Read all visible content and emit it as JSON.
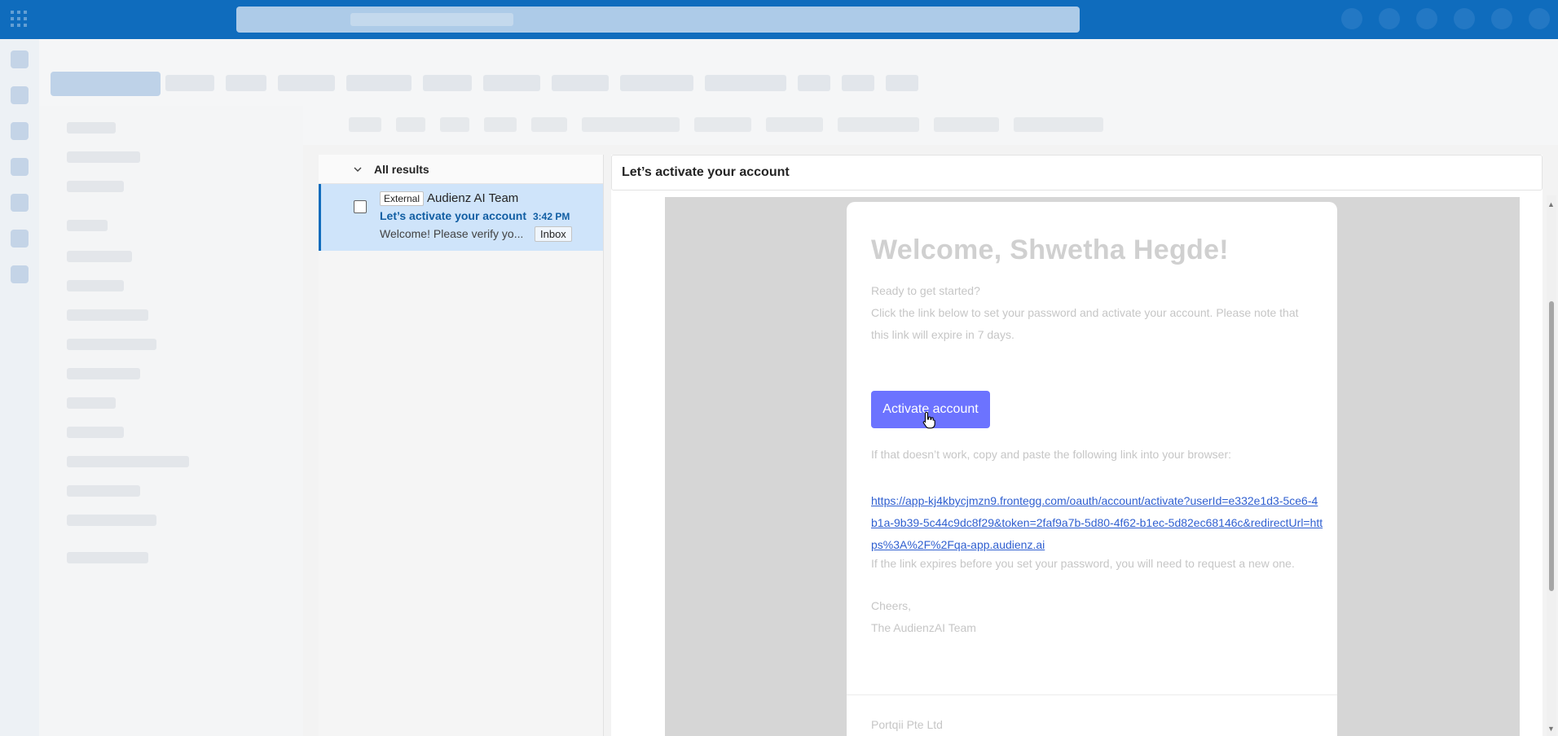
{
  "message_list": {
    "header": "All results",
    "items": [
      {
        "external_tag": "External",
        "sender": "Audienz AI Team",
        "subject": "Let’s activate your account",
        "time": "3:42 PM",
        "preview": "Welcome! Please verify yo...",
        "folder_tag": "Inbox"
      }
    ]
  },
  "reading_pane": {
    "subject": "Let’s activate your account",
    "email": {
      "heading": "Welcome, Shwetha Hegde!",
      "ready": "Ready to get started?",
      "instructions": "Click the link below to set your password and activate your account. Please note that this link will expire in 7 days.",
      "button_label": "Activate account",
      "fallback": "If that doesn’t work, copy and paste the following link into your browser:",
      "activation_link": "https://app-kj4kbycjmzn9.frontegg.com/oauth/account/activate?userId=e332e1d3-5ce6-4b1a-9b39-5c44c9dc8f29&token=2faf9a7b-5d80-4f62-b1ec-5d82ec68146c&redirectUrl=https%3A%2F%2Fqa-app.audienz.ai",
      "expiry_note": "If the link expires before you set your password, you will need to request a new one.",
      "signoff": "Cheers,",
      "team": "The AudienzAI Team",
      "footer_company": "Portqii Pte Ltd"
    }
  },
  "colors": {
    "brand_bar": "#0f6cbd",
    "selected_item": "#cfe4fa",
    "activate_button": "#6c73ff",
    "link": "#2f5fd0"
  },
  "icons": [
    "app-launcher-icon",
    "chevron-down-icon",
    "checkbox-icon",
    "pointer-cursor-icon"
  ]
}
